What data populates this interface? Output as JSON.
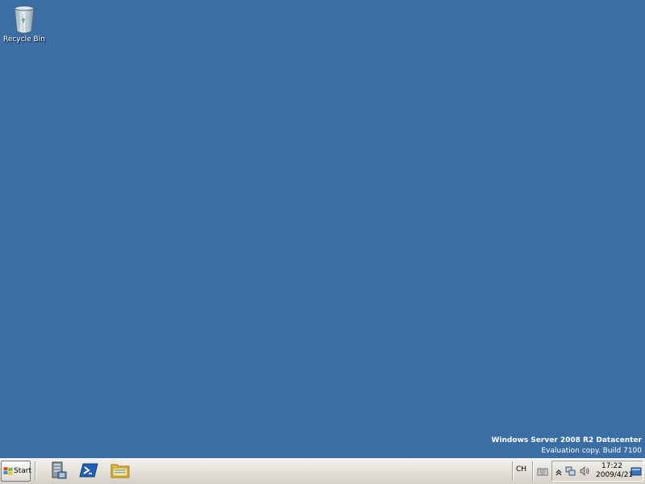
{
  "desktop": {
    "background_color": "#3a6ea5",
    "icons": [
      {
        "label": "Recycle Bin",
        "icon": "recycle-bin-icon"
      }
    ],
    "watermark": {
      "title": "Windows Server 2008 R2 Datacenter",
      "subtitle": "Evaluation copy. Build 7100"
    }
  },
  "taskbar": {
    "start_label": "Start",
    "quick_launch": [
      {
        "icon": "server-manager-icon"
      },
      {
        "icon": "powershell-icon"
      },
      {
        "icon": "explorer-folder-icon"
      }
    ],
    "language": "CH",
    "tray": {
      "icons": [
        "show-hidden-icons-chevron",
        "network-icon",
        "volume-icon"
      ],
      "time": "17:22",
      "date": "2009/4/21"
    }
  }
}
